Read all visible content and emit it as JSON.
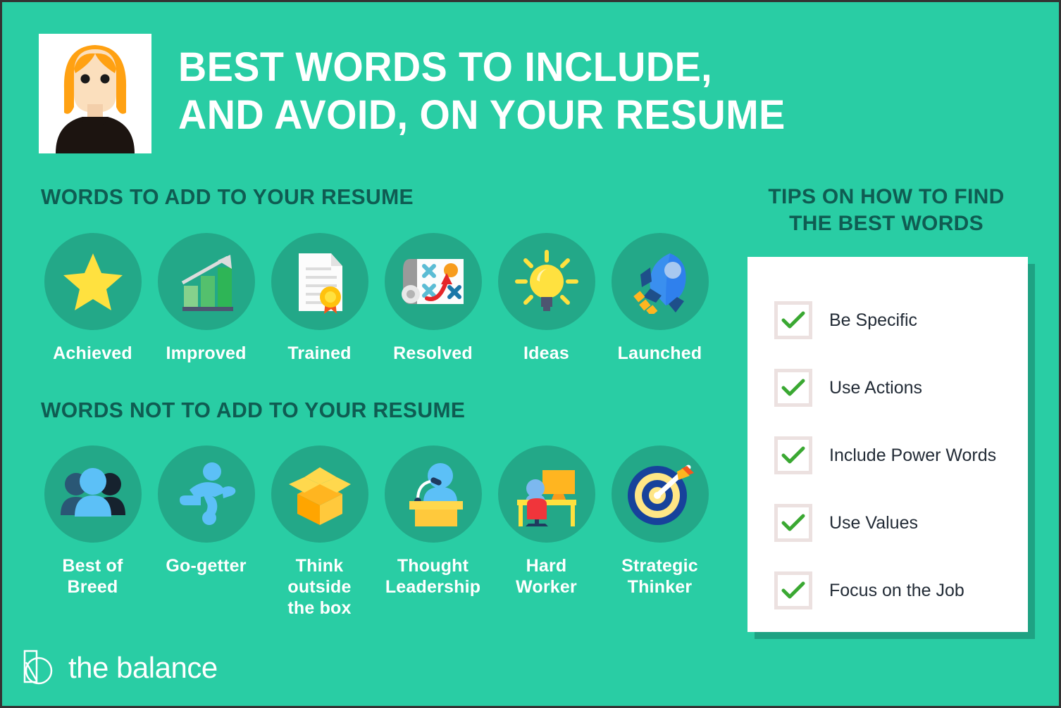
{
  "brand": {
    "background_color": "#29cda4",
    "disc_color": "#23a888",
    "heading_color": "#0f5c52",
    "white": "#ffffff",
    "check_color": "#3aa832",
    "checkbox_border_color": "#ece1e0",
    "card_shadow_color": "#1ea283",
    "logo_text": "the balance",
    "logo_icon": "balance-logo-icon"
  },
  "header": {
    "portrait_alt": "portrait-illustration",
    "title": "BEST WORDS TO INCLUDE,\nAND AVOID, ON YOUR RESUME"
  },
  "sections": {
    "add": {
      "heading": "WORDS TO ADD TO YOUR RESUME",
      "items": [
        {
          "label": "Achieved",
          "icon": "star-icon"
        },
        {
          "label": "Improved",
          "icon": "bar-chart-growth-icon"
        },
        {
          "label": "Trained",
          "icon": "certificate-document-icon"
        },
        {
          "label": "Resolved",
          "icon": "strategy-playbook-icon"
        },
        {
          "label": "Ideas",
          "icon": "lightbulb-icon"
        },
        {
          "label": "Launched",
          "icon": "rocket-icon"
        }
      ]
    },
    "avoid": {
      "heading": "WORDS NOT TO ADD TO YOUR RESUME",
      "items": [
        {
          "label": "Best of\nBreed",
          "icon": "people-group-icon"
        },
        {
          "label": "Go-getter",
          "icon": "running-person-icon"
        },
        {
          "label": "Think\noutside\nthe box",
          "icon": "open-box-icon"
        },
        {
          "label": "Thought\nLeadership",
          "icon": "podium-speaker-icon"
        },
        {
          "label": "Hard\nWorker",
          "icon": "desk-workstation-icon"
        },
        {
          "label": "Strategic\nThinker",
          "icon": "dartboard-target-icon"
        }
      ]
    }
  },
  "tips": {
    "heading": "TIPS ON HOW TO FIND\nTHE BEST WORDS",
    "items": [
      {
        "label": "Be Specific",
        "checked": true
      },
      {
        "label": "Use Actions",
        "checked": true
      },
      {
        "label": "Include Power Words",
        "checked": true
      },
      {
        "label": "Use Values",
        "checked": true
      },
      {
        "label": "Focus on the Job",
        "checked": true
      }
    ]
  }
}
